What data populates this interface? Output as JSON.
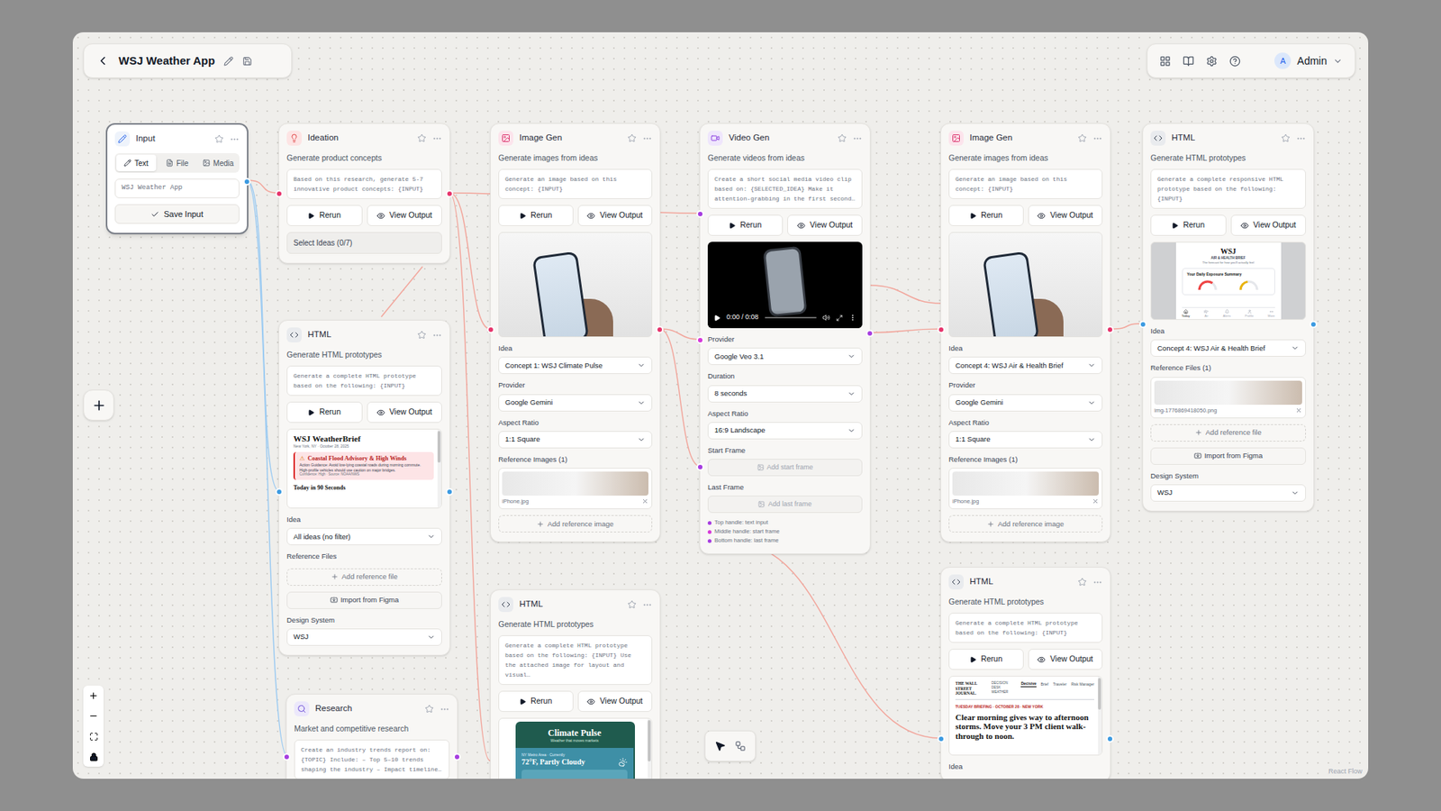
{
  "toolbar": {
    "title": "WSJ Weather App",
    "user": {
      "initial": "A",
      "name": "Admin"
    }
  },
  "attribution": "React Flow",
  "edges": [
    {
      "color": "#f2a69c"
    },
    {
      "color": "#9ccbf2"
    },
    {
      "color": "#9ccbf2"
    },
    {
      "color": "#f2a69c"
    },
    {
      "color": "#f2a69c"
    },
    {
      "color": "#f2a69c"
    },
    {
      "color": "#f2a69c"
    },
    {
      "color": "#f2a69c"
    },
    {
      "color": "#f2a69c"
    },
    {
      "color": "#f2a69c"
    },
    {
      "color": "#f2a69c"
    },
    {
      "color": "#f2a69c"
    },
    {
      "color": "#f2a69c"
    }
  ],
  "nodes": [
    {
      "kind": "input",
      "title": "Input",
      "selected": true,
      "handles": [
        {
          "color": "#3b9ae1"
        }
      ],
      "sections": [
        {
          "kind": "tabs",
          "tabs": [
            {
              "label": "Text",
              "selected": true
            },
            {
              "label": "File",
              "selected": false
            },
            {
              "label": "Media",
              "selected": false
            }
          ]
        },
        {
          "kind": "field",
          "value": "WSJ Weather App"
        },
        {
          "kind": "primary",
          "label": "Save Input"
        }
      ]
    },
    {
      "kind": "ideation",
      "title": "Ideation",
      "selected": false,
      "handles": [
        {
          "color": "#e6336b"
        },
        {
          "color": "#e6336b"
        }
      ],
      "sections": [
        {
          "kind": "text",
          "text": "Generate product concepts"
        },
        {
          "kind": "prompt",
          "text": "Based on this research, generate 5-7 innovative product concepts: {INPUT}"
        },
        {
          "kind": "actions",
          "buttons": [
            "Rerun",
            "View Output"
          ]
        },
        {
          "kind": "chip",
          "text": "Select Ideas (0/7)"
        }
      ]
    },
    {
      "kind": "html",
      "title": "HTML",
      "selected": false,
      "handles": [
        {
          "color": "#3b9ae1"
        },
        {
          "color": "#3b9ae1"
        }
      ],
      "sections": [
        {
          "kind": "text",
          "text": "Generate HTML prototypes"
        },
        {
          "kind": "prompt",
          "text": "Generate a complete HTML prototype based on the following: {INPUT}"
        },
        {
          "kind": "actions",
          "buttons": [
            "Rerun",
            "View Output"
          ]
        },
        {
          "kind": "preview",
          "layout": "weatherbrief",
          "title": "WSJ WeatherBrief",
          "dateline": "New York, NY · October 28, 2025",
          "alert": {
            "icon": "⚠",
            "title": "Coastal Flood Advisory & High Winds",
            "body": "Action Guidance: Avoid low-lying coastal roads during morning commute. High-profile vehicles should use caution on major bridges.",
            "meta": "Confidence: High · Source: NOAA/NWS"
          },
          "next": "Today in 90 Seconds"
        },
        {
          "kind": "select",
          "label": "Idea",
          "value": "All ideas (no filter)"
        },
        {
          "kind": "label",
          "text": "Reference Files"
        },
        {
          "kind": "add",
          "text": "Add reference file"
        },
        {
          "kind": "import",
          "text": "Import from Figma"
        },
        {
          "kind": "select",
          "label": "Design System",
          "value": "WSJ"
        }
      ]
    },
    {
      "kind": "research",
      "title": "Research",
      "selected": false,
      "handles": [
        {
          "color": "#a63de0"
        },
        {
          "color": "#a63de0"
        }
      ],
      "sections": [
        {
          "kind": "text",
          "text": "Market and competitive research"
        },
        {
          "kind": "prompt",
          "text": "Create an industry trends report on: {TOPIC} Include: – Top 5–10 trends shaping the industry – Impact timeline…"
        }
      ]
    },
    {
      "kind": "image",
      "title": "Image Gen",
      "selected": false,
      "handles": [
        {
          "color": "#e6336b"
        },
        {
          "color": "#e6336b"
        }
      ],
      "sections": [
        {
          "kind": "text",
          "text": "Generate images from ideas"
        },
        {
          "kind": "prompt",
          "text": "Generate an image based on this concept: {INPUT}"
        },
        {
          "kind": "actions",
          "buttons": [
            "Rerun",
            "View Output"
          ]
        },
        {
          "kind": "image"
        },
        {
          "kind": "select",
          "label": "Idea",
          "value": "Concept 1: WSJ Climate Pulse"
        },
        {
          "kind": "select",
          "label": "Provider",
          "value": "Google Gemini"
        },
        {
          "kind": "select",
          "label": "Aspect Ratio",
          "value": "1:1 Square"
        },
        {
          "kind": "refs",
          "label": "Reference Images (1)",
          "file": "iPhone.jpg"
        },
        {
          "kind": "add",
          "text": "Add reference image"
        }
      ]
    },
    {
      "kind": "html",
      "title": "HTML",
      "selected": false,
      "handles": [],
      "sections": [
        {
          "kind": "text",
          "text": "Generate HTML prototypes"
        },
        {
          "kind": "prompt",
          "text": "Generate a complete HTML prototype based on the following: {INPUT} Use the attached image for layout and visual…"
        },
        {
          "kind": "actions",
          "buttons": [
            "Rerun",
            "View Output"
          ]
        },
        {
          "kind": "preview",
          "layout": "climate",
          "title": "Climate Pulse",
          "tagline": "Weather that moves markets",
          "location": "NY Metro Area · Currently",
          "current": "72°F, Partly Cloudy"
        }
      ]
    },
    {
      "kind": "video",
      "title": "Video Gen",
      "selected": false,
      "handles": [
        {
          "color": "#a63de0"
        },
        {
          "color": "#d63ad9"
        },
        {
          "color": "#a63de0"
        },
        {
          "color": "#a63de0"
        }
      ],
      "sections": [
        {
          "kind": "text",
          "text": "Generate videos from ideas"
        },
        {
          "kind": "prompt",
          "text": "Create a short social media video clip based on: {SELECTED_IDEA} Make it attention-grabbing in the first second…"
        },
        {
          "kind": "actions",
          "buttons": [
            "Rerun",
            "View Output"
          ]
        },
        {
          "kind": "video",
          "time": "0:00 / 0:08",
          "level": 0
        },
        {
          "kind": "select",
          "label": "Provider",
          "value": "Google Veo 3.1"
        },
        {
          "kind": "select",
          "label": "Duration",
          "value": "8 seconds"
        },
        {
          "kind": "select",
          "label": "Aspect Ratio",
          "value": "16:9 Landscape"
        },
        {
          "kind": "frame",
          "label": "Start Frame",
          "text": "Add start frame"
        },
        {
          "kind": "frame",
          "label": "Last Frame",
          "text": "Add last frame"
        },
        {
          "kind": "legend",
          "items": [
            {
              "text": "Top handle: text input",
              "color": "#a63de0"
            },
            {
              "text": "Middle handle: start frame",
              "color": "#d63ad9"
            },
            {
              "text": "Bottom handle: last frame",
              "color": "#a63de0"
            }
          ]
        }
      ]
    },
    {
      "kind": "image",
      "title": "Image Gen",
      "selected": false,
      "handles": [
        {
          "color": "#e6336b"
        },
        {
          "color": "#e6336b"
        }
      ],
      "sections": [
        {
          "kind": "text",
          "text": "Generate images from ideas"
        },
        {
          "kind": "prompt",
          "text": "Generate an image based on this concept: {INPUT}"
        },
        {
          "kind": "actions",
          "buttons": [
            "Rerun",
            "View Output"
          ]
        },
        {
          "kind": "image"
        },
        {
          "kind": "select",
          "label": "Idea",
          "value": "Concept 4: WSJ Air & Health Brief"
        },
        {
          "kind": "select",
          "label": "Provider",
          "value": "Google Gemini"
        },
        {
          "kind": "select",
          "label": "Aspect Ratio",
          "value": "1:1 Square"
        },
        {
          "kind": "refs",
          "label": "Reference Images (1)",
          "file": "iPhone.jpg"
        },
        {
          "kind": "add",
          "text": "Add reference image"
        }
      ]
    },
    {
      "kind": "html",
      "title": "HTML",
      "selected": false,
      "handles": [
        {
          "color": "#3b9ae1"
        },
        {
          "color": "#3b9ae1"
        }
      ],
      "sections": [
        {
          "kind": "text",
          "text": "Generate HTML prototypes"
        },
        {
          "kind": "prompt",
          "text": "Generate a complete HTML prototype based on the following: {INPUT}"
        },
        {
          "kind": "actions",
          "buttons": [
            "Rerun",
            "View Output"
          ]
        },
        {
          "kind": "preview",
          "layout": "journal",
          "brand": "THE WALL STREET JOURNAL.",
          "section": "DECISION DESK WEATHER",
          "nav": [
            {
              "label": "Decisive",
              "selected": true
            },
            {
              "label": "Brief",
              "selected": false
            },
            {
              "label": "Traveler",
              "selected": false
            },
            {
              "label": "Risk Manager",
              "selected": false
            }
          ],
          "kicker": "TUESDAY BRIEFING · OCTOBER 28 · NEW YORK",
          "headline": "Clear morning gives way to afternoon storms. Move your 3 PM client walk-through to noon."
        },
        {
          "kind": "label",
          "text": "Idea"
        }
      ]
    },
    {
      "kind": "html",
      "title": "HTML",
      "selected": false,
      "handles": [
        {
          "color": "#3b9ae1"
        },
        {
          "color": "#3b9ae1"
        }
      ],
      "sections": [
        {
          "kind": "text",
          "text": "Generate HTML prototypes"
        },
        {
          "kind": "prompt",
          "text": "Generate a complete responsive HTML prototype based on the following: {INPUT}"
        },
        {
          "kind": "actions",
          "buttons": [
            "Rerun",
            "View Output"
          ]
        },
        {
          "kind": "preview",
          "layout": "airhealth",
          "brand": "WSJ",
          "title": "AIR & HEALTH BRIEF",
          "tagline": "The forecast for how you'll actually feel",
          "card": "Your Daily Exposure Summary",
          "gauges": [
            {
              "level": 0.7,
              "color": "#ef4444"
            },
            {
              "level": 0.45,
              "color": "#eab308"
            }
          ],
          "nav": [
            {
              "label": "Today",
              "selected": true
            },
            {
              "label": "Air",
              "selected": false
            },
            {
              "label": "Alerts",
              "selected": false
            },
            {
              "label": "Profile",
              "selected": false
            },
            {
              "label": "More",
              "selected": false
            }
          ]
        },
        {
          "kind": "select",
          "label": "Idea",
          "value": "Concept 4: WSJ Air & Health Brief"
        },
        {
          "kind": "refs",
          "label": "Reference Files (1)",
          "file": "img-1776869418050.png"
        },
        {
          "kind": "add",
          "text": "Add reference file"
        },
        {
          "kind": "import",
          "text": "Import from Figma"
        },
        {
          "kind": "select",
          "label": "Design System",
          "value": "WSJ"
        }
      ]
    }
  ]
}
